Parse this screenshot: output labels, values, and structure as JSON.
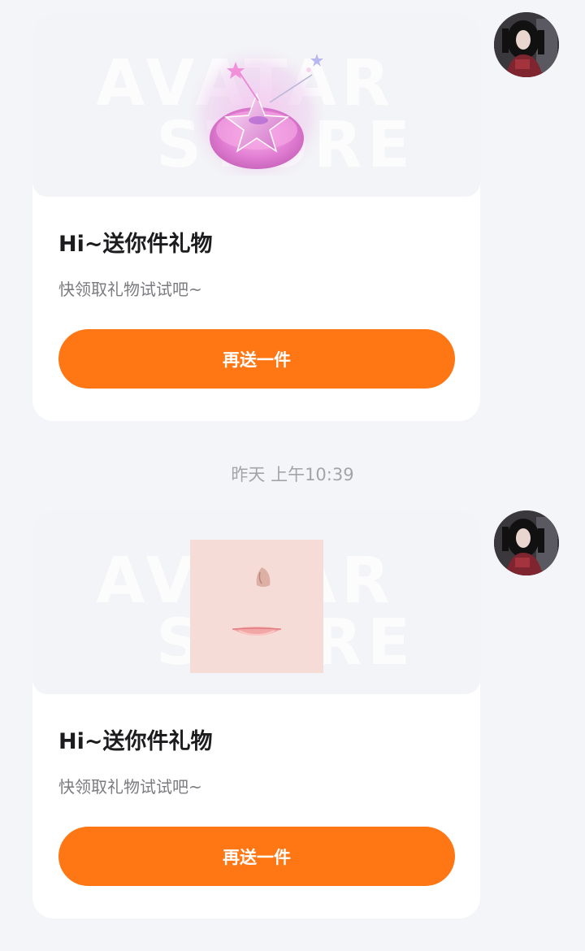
{
  "messages": [
    {
      "gift_image": "star-bowl-gift",
      "title": "Hi~送你件礼物",
      "subtitle": "快领取礼物试试吧~",
      "button_label": "再送一件",
      "watermark_line1": "AVATAR",
      "watermark_line2": "STORE"
    },
    {
      "gift_image": "face-makeup-gift",
      "title": "Hi~送你件礼物",
      "subtitle": "快领取礼物试试吧~",
      "button_label": "再送一件",
      "watermark_line1": "AVATAR",
      "watermark_line2": "STORE"
    }
  ],
  "timestamp": "昨天 上午10:39",
  "colors": {
    "accent": "#ff7614",
    "background": "#f4f5f9",
    "card": "#ffffff",
    "title_text": "#1c1c1e",
    "subtitle_text": "#7a7a7f",
    "timestamp_text": "#a3a4aa"
  }
}
